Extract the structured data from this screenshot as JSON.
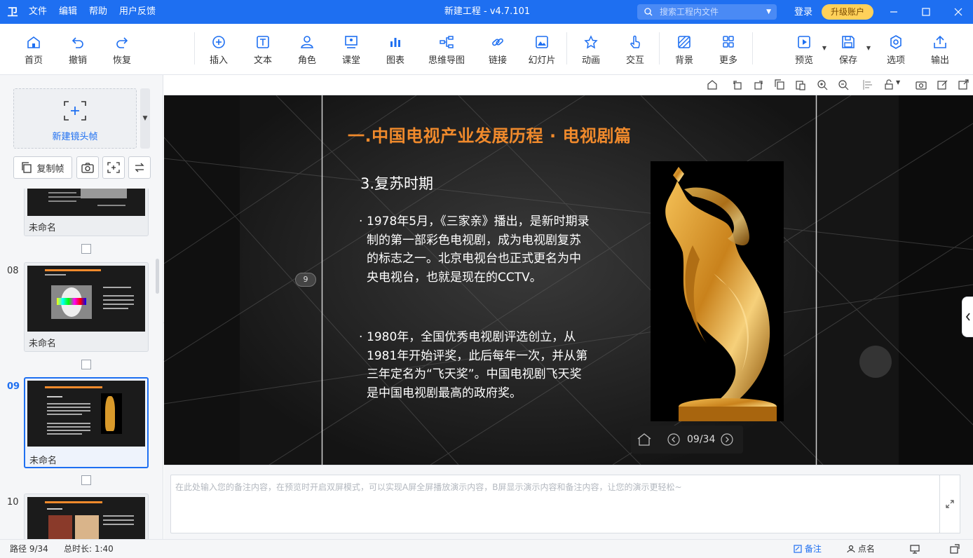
{
  "app": {
    "title": "新建工程 - v4.7.101",
    "menu": [
      "文件",
      "编辑",
      "帮助",
      "用户反馈"
    ],
    "search_placeholder": "搜索工程内文件",
    "login": "登录",
    "upgrade": "升级账户"
  },
  "toolbar": {
    "items": [
      {
        "label": "首页",
        "icon": "home-icon"
      },
      {
        "label": "撤销",
        "icon": "undo-icon"
      },
      {
        "label": "恢复",
        "icon": "redo-icon"
      },
      {
        "label": "插入",
        "icon": "plus-circle-icon"
      },
      {
        "label": "文本",
        "icon": "text-icon"
      },
      {
        "label": "角色",
        "icon": "person-icon"
      },
      {
        "label": "课堂",
        "icon": "classroom-icon"
      },
      {
        "label": "图表",
        "icon": "bar-chart-icon"
      },
      {
        "label": "思维导图",
        "icon": "mindmap-icon"
      },
      {
        "label": "链接",
        "icon": "link-icon"
      },
      {
        "label": "幻灯片",
        "icon": "slides-icon"
      },
      {
        "label": "动画",
        "icon": "star-icon"
      },
      {
        "label": "交互",
        "icon": "hand-icon"
      },
      {
        "label": "背景",
        "icon": "background-icon"
      },
      {
        "label": "更多",
        "icon": "grid-icon"
      },
      {
        "label": "预览",
        "icon": "play-icon"
      },
      {
        "label": "保存",
        "icon": "save-icon"
      },
      {
        "label": "选项",
        "icon": "settings-icon"
      },
      {
        "label": "输出",
        "icon": "export-icon"
      }
    ]
  },
  "left_panel": {
    "new_frame": "新建镜头帧",
    "copy_frame": "复制帧",
    "slides": [
      {
        "num": "",
        "name": "未命名"
      },
      {
        "num": "08",
        "name": "未命名"
      },
      {
        "num": "09",
        "name": "未命名",
        "active": true
      },
      {
        "num": "10",
        "name": ""
      }
    ]
  },
  "slide": {
    "title": "一.中国电视产业发展历程 · 电视剧篇",
    "subtitle": "3.复苏时期",
    "para1": "1978年5月，《三家亲》播出，是新时期录制的第一部彩色电视剧，成为电视剧复苏的标志之一。北京电视台也正式更名为中央电视台，也就是现在的CCTV。",
    "para2": "1980年，全国优秀电视剧评选创立，从1981年开始评奖，此后每年一次，并从第三年定名为“飞天奖”。中国电视剧飞天奖是中国电视剧最高的政府奖。",
    "bullet": "·",
    "badge": "9",
    "pager": "09/34"
  },
  "notes": {
    "placeholder": "在此处输入您的备注内容，在预览时开启双屏模式，可以实现A屏全屏播放演示内容，B屏显示演示内容和备注内容，让您的演示更轻松~"
  },
  "status": {
    "path": "路径 9/34",
    "duration": "总时长: 1:40",
    "notes_label": "备注",
    "rollcall_label": "点名"
  },
  "colors": {
    "accent": "#1e6ff1",
    "title_orange": "#f08a2c",
    "upgrade": "#ffd15a"
  }
}
